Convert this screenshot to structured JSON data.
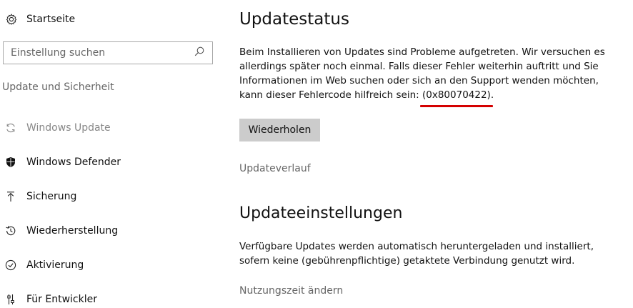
{
  "sidebar": {
    "home": {
      "label": "Startseite",
      "icon": "gear-icon"
    },
    "search": {
      "placeholder": "Einstellung suchen",
      "icon": "search-icon"
    },
    "section_title": "Update und Sicherheit",
    "items": [
      {
        "label": "Windows Update",
        "icon": "refresh-icon",
        "active": true
      },
      {
        "label": "Windows Defender",
        "icon": "shield-icon",
        "active": false
      },
      {
        "label": "Sicherung",
        "icon": "backup-arrow-icon",
        "active": false
      },
      {
        "label": "Wiederherstellung",
        "icon": "history-icon",
        "active": false
      },
      {
        "label": "Aktivierung",
        "icon": "check-circle-icon",
        "active": false
      },
      {
        "label": "Für Entwickler",
        "icon": "developer-sliders-icon",
        "active": false
      }
    ]
  },
  "main": {
    "update_status": {
      "title": "Updatestatus",
      "message_before": "Beim Installieren von Updates sind Probleme aufgetreten. Wir versuchen es allerdings später noch einmal. Falls dieser Fehler weiterhin auftritt und Sie Informationen im Web suchen oder sich an den Support wenden möchten, kann dieser Fehlercode hilfreich sein: ",
      "error_code": "(0x80070422)",
      "message_after": ".",
      "retry_label": "Wiederholen",
      "history_link": "Updateverlauf"
    },
    "update_settings": {
      "title": "Updateeinstellungen",
      "description": "Verfügbare Updates werden automatisch heruntergeladen und installiert, sofern keine (gebührenpflichtige) getaktete Verbindung genutzt wird.",
      "usage_link": "Nutzungszeit ändern"
    }
  },
  "colors": {
    "accent_underline": "#d40000",
    "button_bg": "#cccccc",
    "muted_text": "#666666"
  }
}
